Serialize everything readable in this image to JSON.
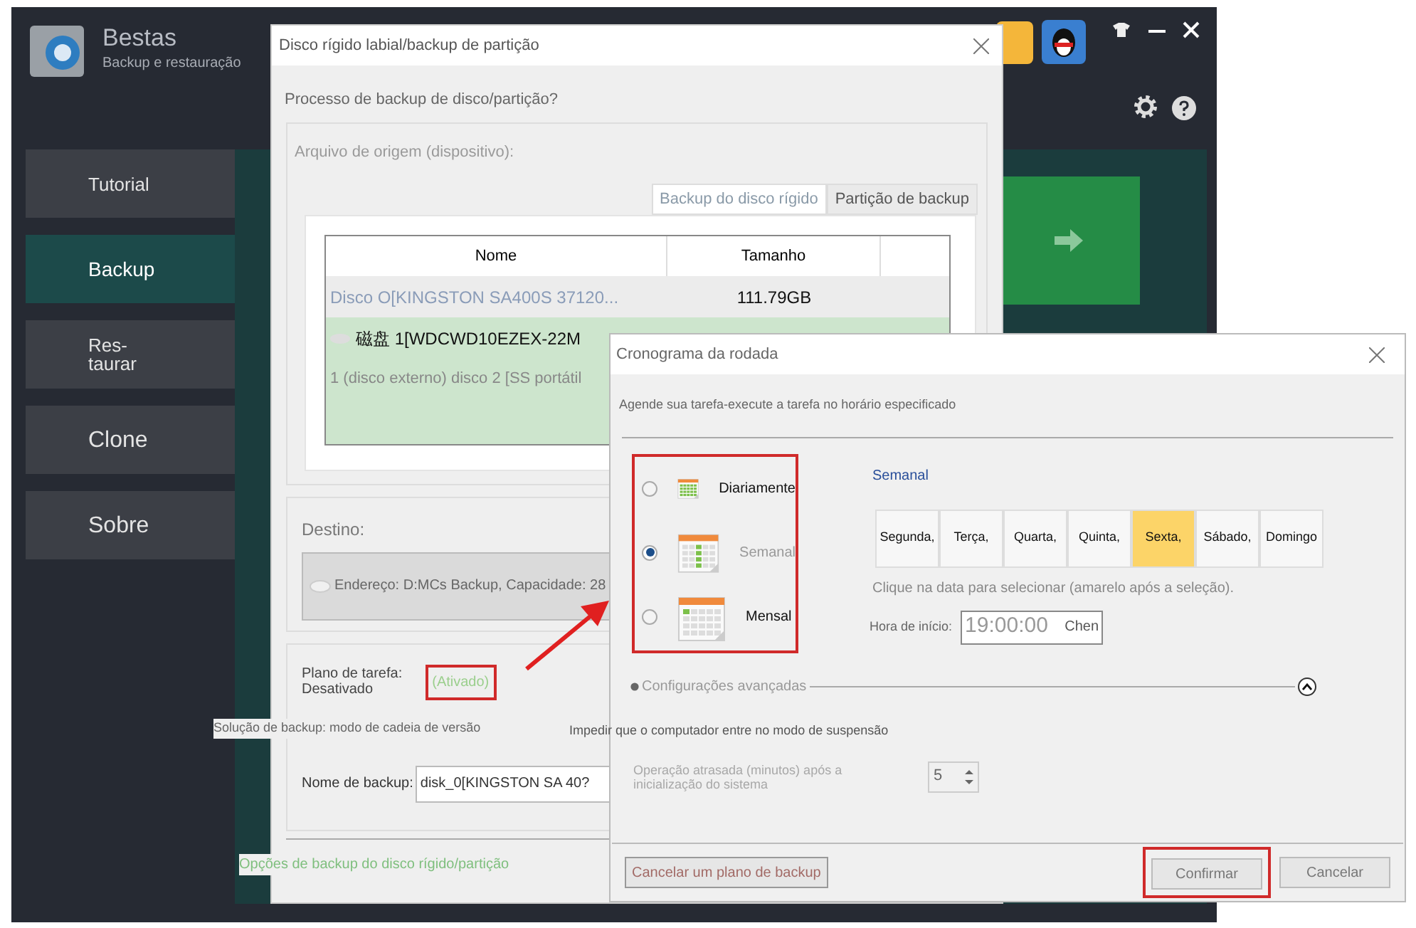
{
  "app": {
    "title": "Bestas",
    "subtitle": "Backup e restauração"
  },
  "sidebar": {
    "items": [
      {
        "label": "Tutorial",
        "selected": false
      },
      {
        "label": "Backup",
        "selected": true
      },
      {
        "label": "Res-\ntaurar",
        "selected": false
      },
      {
        "label": "Clone",
        "selected": false
      },
      {
        "label": "Sobre",
        "selected": false
      }
    ]
  },
  "backup_dialog": {
    "title": "Disco rígido labial/backup de partição",
    "question": "Processo de backup de disco/partição?",
    "source_label": "Arquivo de origem (dispositivo):",
    "tabs": [
      {
        "label": "Backup do disco rígido",
        "selected": true
      },
      {
        "label": "Partição de backup",
        "selected": false
      }
    ],
    "table": {
      "columns": [
        "Nome",
        "Tamanho"
      ],
      "rows": [
        {
          "name": "Disco O[KINGSTON SA400S 37120...",
          "size": "111.79GB",
          "selected": false,
          "kind": "plain"
        },
        {
          "name": "磁盘 1[WDCWD10EZEX-22M",
          "size": "",
          "selected": true,
          "kind": "disk"
        },
        {
          "name": "1 (disco externo) disco 2 [SS portátil",
          "size": "",
          "selected": true,
          "kind": "plain"
        }
      ]
    },
    "destination_label": "Destino:",
    "destination": "Endereço: D:MCs Backup, Capacidade: 28",
    "task_plan_label": "Plano de tarefa:\nDesativado",
    "task_plan_link": "(Ativado)",
    "backup_solution": "Solução de backup: modo de cadeia de versão",
    "prevent_sleep": "Impedir que o computador entre no modo de suspensão",
    "backup_name_label": "Nome de backup:",
    "backup_name": "disk_0[KINGSTON SA 40?",
    "options_link": "Opções de backup do disco rígido/partição"
  },
  "schedule_dialog": {
    "title": "Cronograma da rodada",
    "description": "Agende sua tarefa-execute a tarefa no horário especificado",
    "modes": [
      {
        "label": "Diariamente",
        "selected": false
      },
      {
        "label": "Semanal",
        "selected": true
      },
      {
        "label": "Mensal",
        "selected": false
      }
    ],
    "mode_heading": "Semanal",
    "days": [
      {
        "label": "Segunda,",
        "selected": false
      },
      {
        "label": "Terça,",
        "selected": false
      },
      {
        "label": "Quarta,",
        "selected": false
      },
      {
        "label": "Quinta,",
        "selected": false
      },
      {
        "label": "Sexta,",
        "selected": true
      },
      {
        "label": "Sábado,",
        "selected": false
      },
      {
        "label": "Domingo",
        "selected": false
      }
    ],
    "hint": "Clique na data para selecionar (amarelo após a seleção).",
    "start_label": "Hora de início:",
    "start_time": "19:00:00",
    "start_suffix": "Chen",
    "advanced": "Configurações avançadas",
    "expanded": true,
    "delay_label": "Operação atrasada (minutos) após a inicialização do sistema",
    "delay_value": "5",
    "buttons": {
      "cancel_plan": "Cancelar um plano de backup",
      "confirm": "Confirmar",
      "cancel": "Cancelar"
    }
  }
}
